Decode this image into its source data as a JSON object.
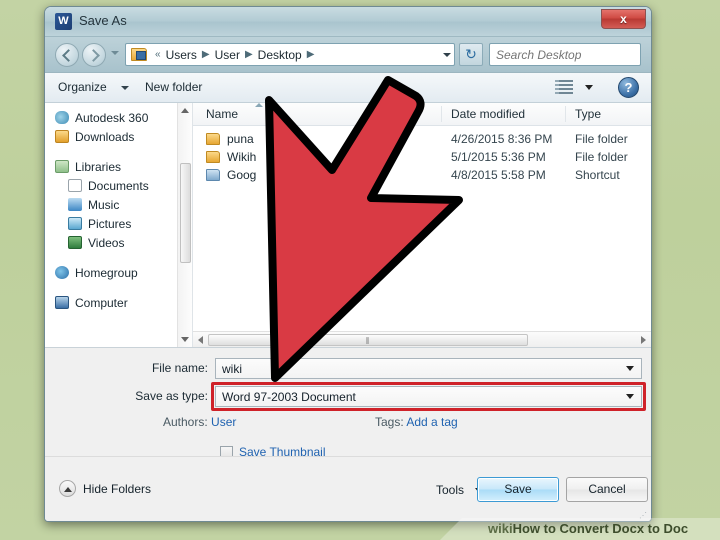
{
  "window": {
    "title": "Save As",
    "app_icon": "word-icon",
    "app_icon_glyph": "W",
    "close_label": "x"
  },
  "navbar": {
    "back_icon": "back-arrow-icon",
    "forward_icon": "forward-arrow-icon",
    "recent_pages_icon": "chevron-down-icon",
    "breadcrumb_overflow": "«",
    "breadcrumbs": [
      "Users",
      "User",
      "Desktop"
    ],
    "breadcrumb_separator": "▶",
    "address_dropdown_icon": "chevron-down-icon",
    "refresh_icon": "refresh-icon",
    "refresh_glyph": "↻",
    "search": {
      "placeholder": "Search Desktop",
      "value": "",
      "icon": "search-icon",
      "icon_glyph": "⚲"
    }
  },
  "commandbar": {
    "organize_label": "Organize",
    "organize_caret_icon": "chevron-down-icon",
    "new_folder_label": "New folder",
    "view_icon": "view-layout-icon",
    "view_caret_icon": "chevron-down-icon",
    "help_icon": "help-icon",
    "help_glyph": "?"
  },
  "navpane": {
    "scroll_up_icon": "scroll-up-arrow-icon",
    "scroll_down_icon": "scroll-down-arrow-icon",
    "items": [
      {
        "label": "Autodesk 360",
        "icon": "cloud-icon",
        "indent": false
      },
      {
        "label": "Downloads",
        "icon": "downloads-icon",
        "indent": false
      },
      {
        "label": "Libraries",
        "icon": "libraries-icon",
        "indent": false
      },
      {
        "label": "Documents",
        "icon": "document-icon",
        "indent": true
      },
      {
        "label": "Music",
        "icon": "music-icon",
        "indent": true
      },
      {
        "label": "Pictures",
        "icon": "picture-icon",
        "indent": true
      },
      {
        "label": "Videos",
        "icon": "video-icon",
        "indent": true
      },
      {
        "label": "Homegroup",
        "icon": "homegroup-icon",
        "indent": false
      },
      {
        "label": "Computer",
        "icon": "computer-icon",
        "indent": false
      }
    ]
  },
  "filelist": {
    "columns": [
      "Name",
      "Date modified",
      "Type"
    ],
    "sort_indicator_icon": "sort-ascending-icon",
    "rows": [
      {
        "name": "puna",
        "date": "4/26/2015 8:36 PM",
        "type": "File folder",
        "icon": "folder-icon"
      },
      {
        "name": "Wikih",
        "date": "5/1/2015 5:36 PM",
        "type": "File folder",
        "icon": "folder-icon"
      },
      {
        "name": "Goog",
        "date": "4/8/2015 5:58 PM",
        "type": "Shortcut",
        "icon": "shortcut-icon"
      }
    ],
    "hscroll": {
      "left_icon": "scroll-left-arrow-icon",
      "right_icon": "scroll-right-arrow-icon",
      "grip": "⫴"
    }
  },
  "form": {
    "file_name_label": "File name:",
    "file_name_value": "wiki",
    "file_name_caret_icon": "chevron-down-icon",
    "save_as_type_label": "Save as type:",
    "save_as_type_value": "Word 97-2003 Document",
    "save_as_type_caret_icon": "chevron-down-icon",
    "authors_label": "Authors:",
    "authors_value": "User",
    "tags_label": "Tags:",
    "tags_value": "Add a tag",
    "save_thumbnail_label": "Save Thumbnail",
    "save_thumbnail_checked": false
  },
  "footer": {
    "hide_folders_label": "Hide Folders",
    "hide_folders_icon": "collapse-up-icon",
    "tools_label": "Tools",
    "tools_caret_icon": "chevron-down-icon",
    "save_label": "Save",
    "cancel_label": "Cancel",
    "resize_grip_icon": "resize-grip-icon"
  },
  "annotation": {
    "arrow_icon": "red-pointer-arrow",
    "arrow_color": "#d93a44",
    "arrow_outline_color": "#000000",
    "highlight_color": "#cf2229",
    "highlight_target": "save-as-type-dropdown"
  },
  "watermark": {
    "brand_light": "wiki",
    "brand_bold": "How",
    "text": " to Convert Docx to Doc"
  },
  "colors": {
    "background": "#bfd19e",
    "titlebar": "#b2cbd4",
    "accent_blue": "#1f62b0",
    "close_red": "#cf4a43"
  }
}
